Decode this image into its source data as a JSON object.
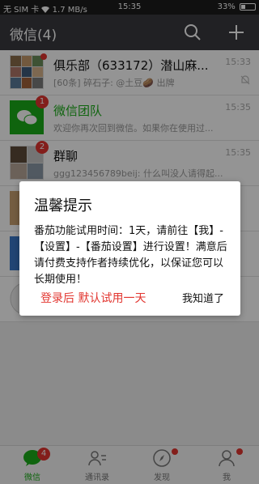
{
  "status_bar": {
    "carrier": "无 SIM 卡",
    "speed": "1.7 MB/s",
    "time": "15:35",
    "battery": "33%",
    "battery_level": 0.33
  },
  "app_bar": {
    "title": "微信(4)",
    "search_icon": "search-icon",
    "add_icon": "plus-icon"
  },
  "chats": [
    {
      "name": "俱乐部（633172）潜山麻...",
      "preview": "[60条] 碎石子: @土豆🥔 出牌",
      "time": "15:33",
      "badge": "",
      "dot": true,
      "muted": true
    },
    {
      "name": "微信团队",
      "preview": "欢迎你再次回到微信。如果你在使用过...",
      "time": "15:35",
      "badge": "1",
      "dot": false,
      "muted": false
    },
    {
      "name": "群聊",
      "preview": "ggg123456789beij: 什么叫没人请得起...",
      "time": "15:35",
      "badge": "2",
      "dot": false,
      "muted": false
    }
  ],
  "dialog": {
    "title": "温馨提示",
    "message": "番茄功能试用时间：1天，请前往【我】-【设置】-【番茄设置】进行设置！满意后请付费支持作者持续优化，以保证您可以长期使用！",
    "left_button": "登录后 默认试用一天",
    "right_button": "我知道了"
  },
  "tabs": [
    {
      "label": "微信",
      "badge": "4",
      "active": true
    },
    {
      "label": "通讯录",
      "badge": "",
      "active": false
    },
    {
      "label": "发现",
      "badge": "",
      "active": false,
      "dot": true
    },
    {
      "label": "我",
      "badge": "",
      "active": false,
      "dot": true
    }
  ],
  "colors": {
    "accent": "#1aad19",
    "badge": "#e2352f",
    "appbar": "#393a3f"
  }
}
